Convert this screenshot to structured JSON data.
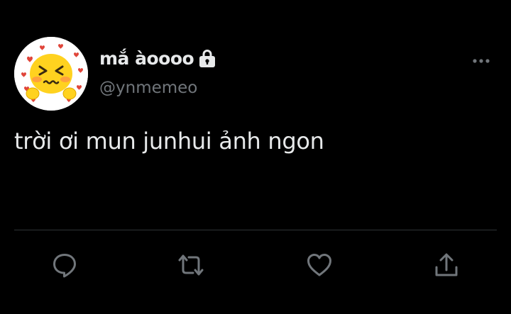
{
  "tweet": {
    "display_name": "mắ àoooo",
    "handle": "@ynmemeo",
    "text": "trời ơi mun junhui ảnh ngon",
    "protected": true
  },
  "icons": {
    "more": "more-horizontal-icon",
    "lock": "lock-icon",
    "reply": "reply-icon",
    "retweet": "retweet-icon",
    "like": "heart-icon",
    "share": "share-icon"
  },
  "colors": {
    "background": "#000000",
    "primary_text": "#e7e9ea",
    "secondary_text": "#71767b",
    "divider": "#2f3336",
    "avatar_emoji": "#ffd21f"
  }
}
